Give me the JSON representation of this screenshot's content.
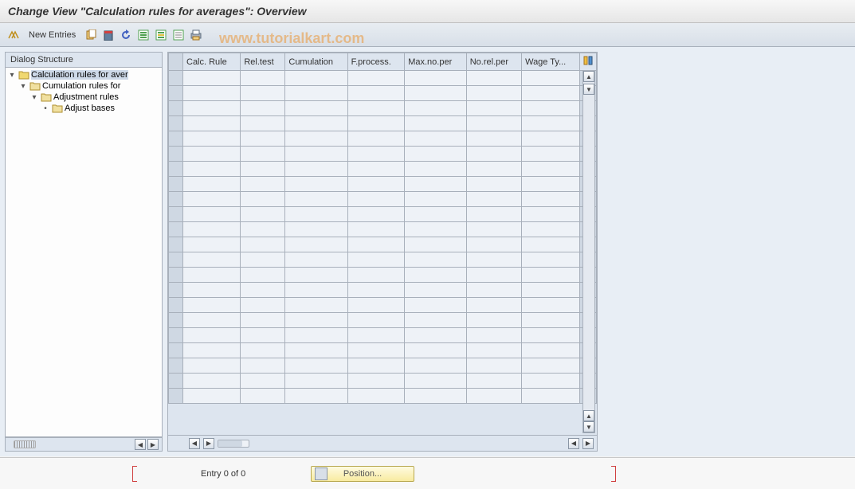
{
  "title": "Change View \"Calculation rules for averages\": Overview",
  "toolbar": {
    "new_entries_label": "New Entries"
  },
  "watermark": "www.tutorialkart.com",
  "tree": {
    "header": "Dialog Structure",
    "items": [
      {
        "label": "Calculation rules for aver",
        "level": 0,
        "open": true,
        "selected": true
      },
      {
        "label": "Cumulation rules for",
        "level": 1,
        "open": false,
        "expander": true
      },
      {
        "label": "Adjustment rules",
        "level": 2,
        "open": false,
        "expander": true
      },
      {
        "label": "Adjust bases",
        "level": 3,
        "open": false,
        "expander": false,
        "bullet": true
      }
    ]
  },
  "table": {
    "columns": [
      "Calc. Rule",
      "Rel.test",
      "Cumulation",
      "F.process.",
      "Max.no.per",
      "No.rel.per",
      "Wage Ty..."
    ],
    "row_count": 22
  },
  "status": {
    "position_label": "Position...",
    "entry_label": "Entry 0 of 0"
  }
}
